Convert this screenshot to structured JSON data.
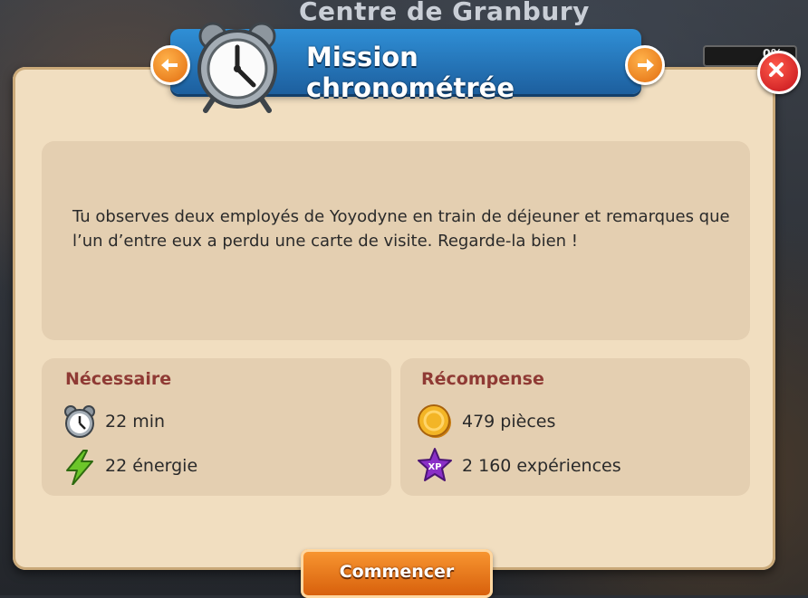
{
  "background": {
    "location_title": "Centre de Granbury",
    "progress_text": "0%",
    "progress_value": 0
  },
  "dialog": {
    "title": "Mission chronométrée",
    "description": "Tu observes deux employés de Yoyodyne en train de déjeuner et remarques que l’un d’entre eux a perdu une carte de visite. Regarde-la bien !",
    "required": {
      "title": "Nécessaire",
      "items": [
        {
          "icon": "alarm-clock-icon",
          "text": "22 min"
        },
        {
          "icon": "lightning-icon",
          "text": "22 énergie"
        }
      ]
    },
    "reward": {
      "title": "Récompense",
      "items": [
        {
          "icon": "coin-icon",
          "text": "479 pièces"
        },
        {
          "icon": "xp-star-icon",
          "text": "2 160 expériences",
          "badge": "XP"
        }
      ]
    },
    "start_button": "Commencer"
  },
  "colors": {
    "banner": "#1d5f9e",
    "panel": "#f1dec0",
    "section_title": "#8f3a34",
    "button": "#f08a24"
  }
}
